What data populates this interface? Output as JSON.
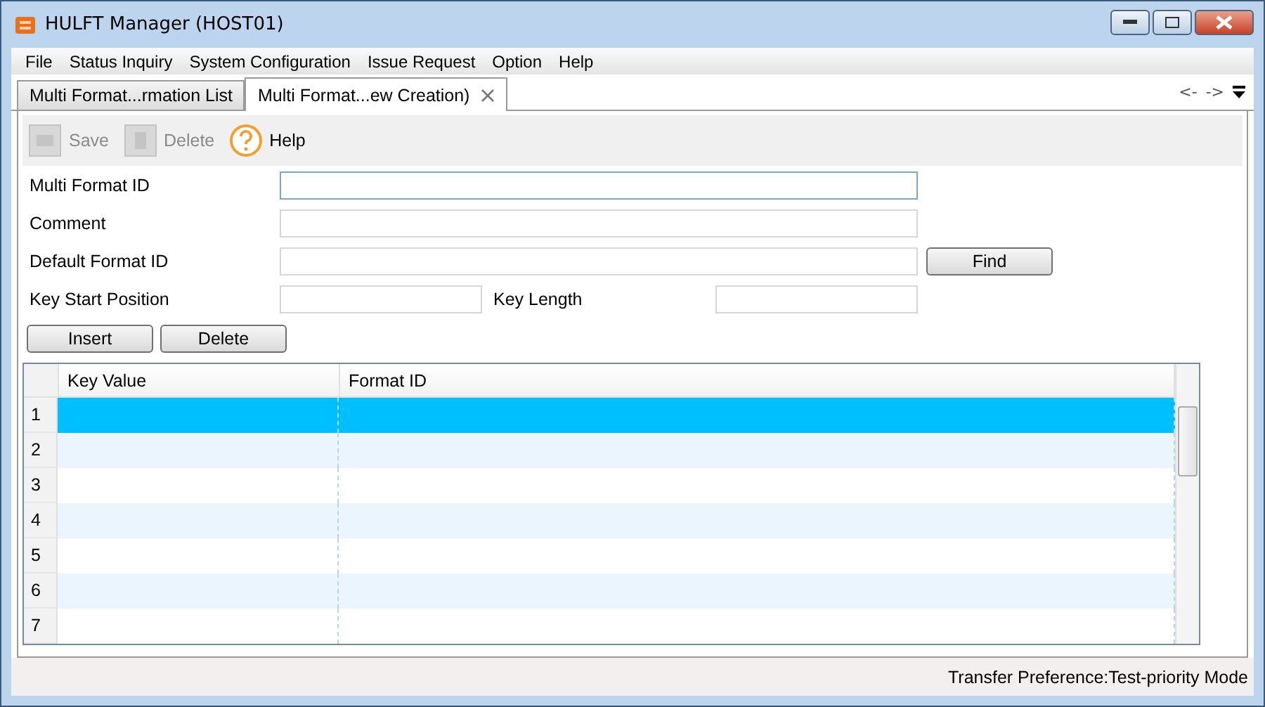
{
  "window": {
    "title": "HULFT Manager (HOST01)"
  },
  "menu": [
    "File",
    "Status Inquiry",
    "System Configuration",
    "Issue Request",
    "Option",
    "Help"
  ],
  "tabs": [
    {
      "label": "Multi Format...rmation List",
      "selected": false,
      "closable": false
    },
    {
      "label": "Multi Format...ew Creation)",
      "selected": true,
      "closable": true
    }
  ],
  "tab_nav": {
    "back": "<-",
    "forward": "->"
  },
  "toolbar": [
    {
      "kind": "save",
      "label": "Save",
      "disabled": true
    },
    {
      "kind": "delete",
      "label": "Delete",
      "disabled": true
    },
    {
      "kind": "help",
      "label": "Help",
      "disabled": false
    }
  ],
  "form": [
    {
      "kind": "wide",
      "label": "Multi Format ID",
      "focused": true
    },
    {
      "kind": "wide",
      "label": "Comment",
      "focused": false
    },
    {
      "kind": "find",
      "label": "Default Format ID",
      "focused": false,
      "button": "Find"
    },
    {
      "kind": "pair",
      "label": "Key Start Position",
      "focused": false,
      "label2": "Key Length"
    }
  ],
  "row_buttons": [
    "Insert",
    "Delete"
  ],
  "table": {
    "columns": [
      "Key Value",
      "Format ID"
    ],
    "rows": [
      {
        "number": "1",
        "selected": true
      },
      {
        "number": "2",
        "selected": false
      },
      {
        "number": "3",
        "selected": false
      },
      {
        "number": "4",
        "selected": false
      },
      {
        "number": "5",
        "selected": false
      },
      {
        "number": "6",
        "selected": false
      },
      {
        "number": "7",
        "selected": false
      }
    ]
  },
  "status_bar": "Transfer Preference:Test-priority Mode"
}
